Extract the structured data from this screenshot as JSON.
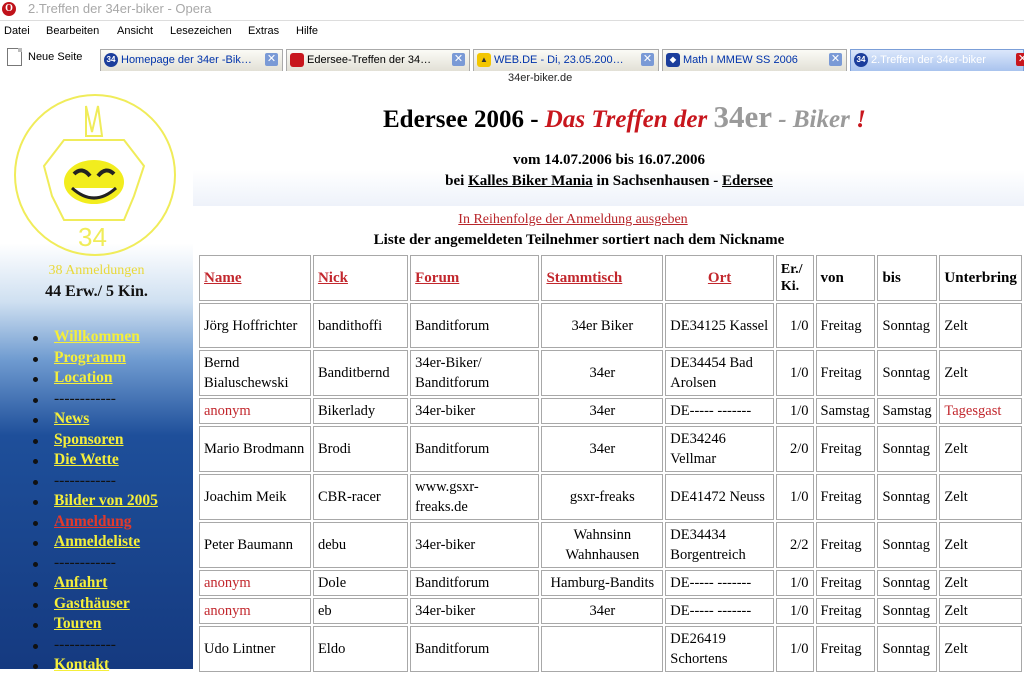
{
  "window": {
    "title": "2.Treffen der 34er-biker - Opera",
    "icon": "opera-icon"
  },
  "menu": [
    "Datei",
    "Bearbeiten",
    "Ansicht",
    "Lesezeichen",
    "Extras",
    "Hilfe"
  ],
  "tabs": {
    "new_page": "Neue Seite",
    "items": [
      {
        "label": "Homepage der 34er -Bik…",
        "icon": "site-34-icon"
      },
      {
        "label": "Edersee-Treffen der 34…",
        "icon": "red-flag-icon"
      },
      {
        "label": "WEB.DE - Di, 23.05.200…",
        "icon": "web-de-icon"
      },
      {
        "label": "Math I MMEW SS 2006",
        "icon": "blue-diamond-icon"
      },
      {
        "label": "2.Treffen der 34er-biker",
        "icon": "site-34-icon"
      }
    ],
    "url_hint": "34er-biker.de"
  },
  "sidebar": {
    "logo_text": "34",
    "registrations": "38 Anmeldungen",
    "counts": "44 Erw./ 5 Kin.",
    "nav": [
      {
        "label": "Willkommen"
      },
      {
        "label": "Programm"
      },
      {
        "label": "Location"
      },
      {
        "label": "------------"
      },
      {
        "label": "News"
      },
      {
        "label": "Sponsoren"
      },
      {
        "label": "Die Wette"
      },
      {
        "label": "------------"
      },
      {
        "label": "Bilder von 2005"
      },
      {
        "label": "Anmeldung"
      },
      {
        "label": "Anmeldeliste"
      },
      {
        "label": "------------"
      },
      {
        "label": "Anfahrt"
      },
      {
        "label": "Gasthäuser"
      },
      {
        "label": "Touren"
      },
      {
        "label": "------------"
      },
      {
        "label": "Kontakt"
      }
    ]
  },
  "header": {
    "title_a": "Edersee 2006 - ",
    "title_b": "Das Treffen der ",
    "title_c": "34er",
    "title_d": " - Biker",
    "title_e": " !",
    "dates": "vom 14.07.2006 bis 16.07.2006",
    "loc_prefix": "bei ",
    "loc_venue": "Kalles Biker Mania",
    "loc_mid": " in Sachsenhausen - ",
    "loc_place": "Edersee"
  },
  "list": {
    "order_link": "In Reihenfolge der Anmeldung ausgeben",
    "title": "Liste der angemeldeten Teilnehmer sortiert nach dem Nickname",
    "columns": [
      "Name",
      "Nick",
      "Forum",
      "Stammtisch",
      "Ort",
      "Er./ Ki.",
      "von",
      "bis",
      "Unterbring"
    ],
    "rows": [
      {
        "name": "Jörg Hoffrichter",
        "nick": "bandithoffi",
        "forum": "Banditforum",
        "stammtisch": "34er Biker",
        "ort": "DE34125 Kassel",
        "erki": "1/0",
        "von": "Freitag",
        "bis": "Sonntag",
        "unterbringung": "Zelt"
      },
      {
        "name": "Bernd Bialuschewski",
        "nick": "Banditbernd",
        "forum": "34er-Biker/ Banditforum",
        "stammtisch": "34er",
        "ort": "DE34454 Bad Arolsen",
        "erki": "1/0",
        "von": "Freitag",
        "bis": "Sonntag",
        "unterbringung": "Zelt"
      },
      {
        "name": "anonym",
        "nick": "Bikerlady",
        "forum": "34er-biker",
        "stammtisch": "34er",
        "ort": "DE----- -------",
        "erki": "1/0",
        "von": "Samstag",
        "bis": "Samstag",
        "unterbringung": "Tagesgast"
      },
      {
        "name": "Mario Brodmann",
        "nick": "Brodi",
        "forum": "Banditforum",
        "stammtisch": "34er",
        "ort": "DE34246 Vellmar",
        "erki": "2/0",
        "von": "Freitag",
        "bis": "Sonntag",
        "unterbringung": "Zelt"
      },
      {
        "name": "Joachim Meik",
        "nick": "CBR-racer",
        "forum": "www.gsxr- freaks.de",
        "stammtisch": "gsxr-freaks",
        "ort": "DE41472 Neuss",
        "erki": "1/0",
        "von": "Freitag",
        "bis": "Sonntag",
        "unterbringung": "Zelt"
      },
      {
        "name": "Peter Baumann",
        "nick": "debu",
        "forum": "34er-biker",
        "stammtisch": "Wahnsinn Wahnhausen",
        "ort": "DE34434 Borgentreich",
        "erki": "2/2",
        "von": "Freitag",
        "bis": "Sonntag",
        "unterbringung": "Zelt"
      },
      {
        "name": "anonym",
        "nick": "Dole",
        "forum": "Banditforum",
        "stammtisch": "Hamburg-Bandits",
        "ort": "DE----- -------",
        "erki": "1/0",
        "von": "Freitag",
        "bis": "Sonntag",
        "unterbringung": "Zelt"
      },
      {
        "name": "anonym",
        "nick": "eb",
        "forum": "34er-biker",
        "stammtisch": "34er",
        "ort": "DE----- -------",
        "erki": "1/0",
        "von": "Freitag",
        "bis": "Sonntag",
        "unterbringung": "Zelt"
      },
      {
        "name": "Udo Lintner",
        "nick": "Eldo",
        "forum": "Banditforum",
        "stammtisch": "",
        "ort": "DE26419 Schortens",
        "erki": "1/0",
        "von": "Freitag",
        "bis": "Sonntag",
        "unterbringung": "Zelt"
      }
    ]
  },
  "colors": {
    "accent_red": "#c2272d",
    "nav_yellow": "#f5ef3a",
    "sidebar_blue": "#153a80"
  }
}
